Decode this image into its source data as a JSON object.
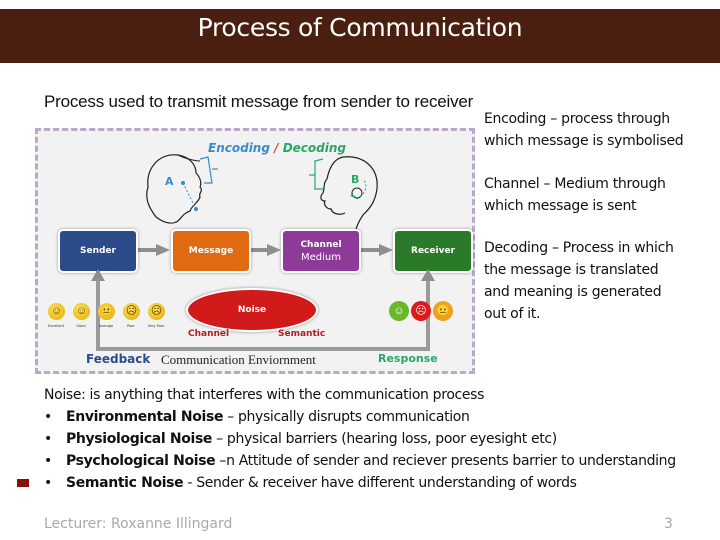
{
  "slide": {
    "title": "Process of Communication",
    "subtitle": "Process used to transmit message from sender to receiver",
    "header_color": "#4a1f10"
  },
  "diagram": {
    "encoding_label": "Encoding",
    "slash": "/",
    "decoding_label": "Decoding",
    "point_a": "A",
    "point_b": "B",
    "boxes": [
      {
        "label": "Sender",
        "color": "#2c4b8a"
      },
      {
        "label": "Message",
        "color": "#e06a12"
      },
      {
        "label": "Channel",
        "sub": "Medium",
        "color": "#8e3a98"
      },
      {
        "label": "Receiver",
        "color": "#2b7a2a"
      }
    ],
    "noise_label": "Noise",
    "noise_sub_left": "Channel",
    "noise_sub_right": "Semantic",
    "feedback_faces": [
      {
        "label": "Excellent",
        "glyph": "☺"
      },
      {
        "label": "Good",
        "glyph": "☺"
      },
      {
        "label": "Average",
        "glyph": "😐"
      },
      {
        "label": "Poor",
        "glyph": "☹"
      },
      {
        "label": "Very Poor",
        "glyph": "☹"
      }
    ],
    "response_faces": [
      {
        "label": "positive",
        "color": "#6ab82a",
        "glyph": "☺"
      },
      {
        "label": "negative",
        "color": "#e01a1a",
        "glyph": "☹"
      },
      {
        "label": "neutral",
        "color": "#f0a020",
        "glyph": "😐"
      }
    ],
    "feedback_label": "Feedback",
    "environment_label": "Communication Enviornment",
    "response_label": "Response"
  },
  "definitions": [
    {
      "line1": "Encoding – process through",
      "line2": "which message is symbolised"
    },
    {
      "line1": "Channel – Medium through",
      "line2": "which message is sent"
    },
    {
      "line1": "Decoding – Process in which",
      "line2": "the message is translated",
      "line3": "and meaning is generated",
      "line4": "out of it."
    }
  ],
  "noise": {
    "intro": "Noise: is anything that interferes with the communication process",
    "bullet_char": "•",
    "types": [
      {
        "name": "Environmental Noise",
        "desc": " – physically disrupts communication"
      },
      {
        "name": "Physiological Noise",
        "desc": " – physical barriers (hearing loss, poor eyesight etc)"
      },
      {
        "name": "Psychological Noise",
        "desc": " –n Attitude of sender and reciever presents barrier to understanding"
      },
      {
        "name": "Semantic Noise",
        "desc": " - Sender & receiver have different understanding of words"
      }
    ]
  },
  "footer": {
    "lecturer": "Lecturer: Roxanne Illingard",
    "page": "3"
  }
}
